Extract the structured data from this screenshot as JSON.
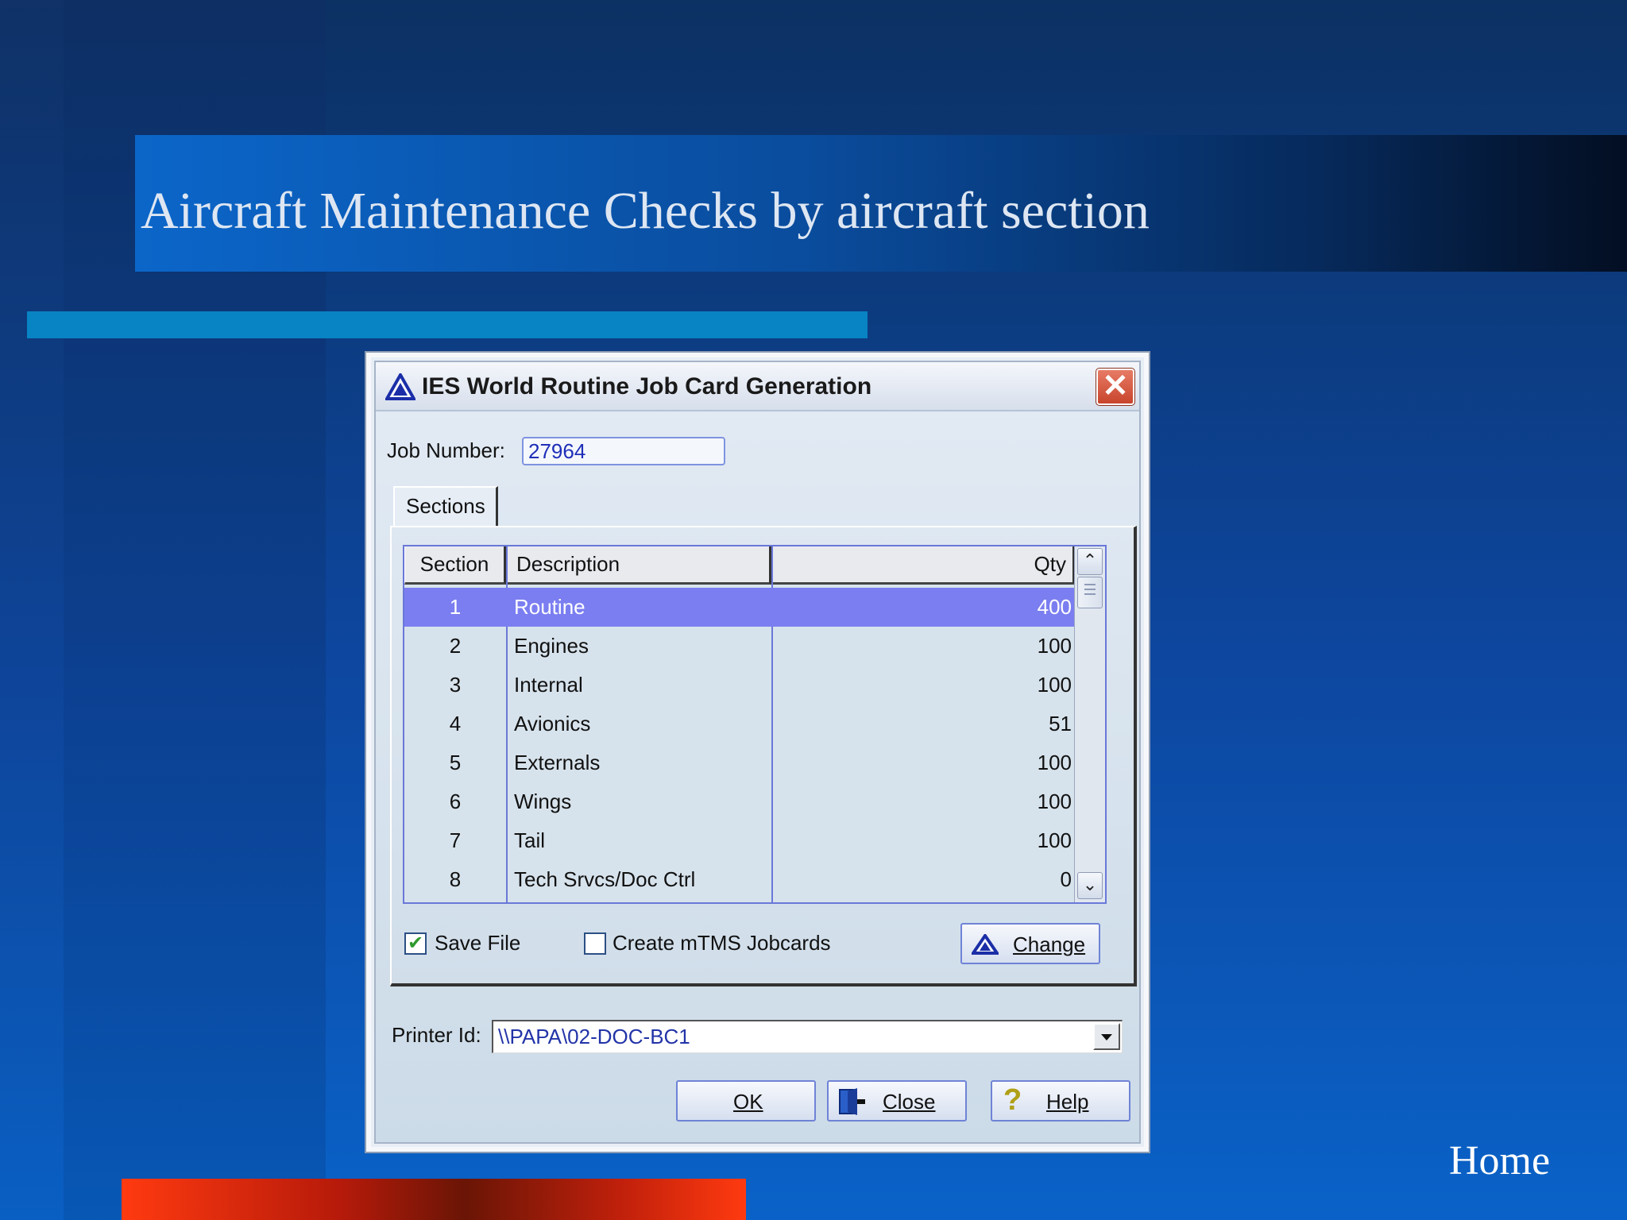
{
  "slide": {
    "title": "Aircraft Maintenance Checks by aircraft section",
    "home_link": "Home"
  },
  "dialog": {
    "title": "IES World Routine Job Card Generation",
    "close_glyph": "✕",
    "job_number_label": "Job Number:",
    "job_number_value": "27964",
    "tab_label": "Sections",
    "grid": {
      "headers": {
        "section": "Section",
        "description": "Description",
        "qty": "Qty"
      },
      "rows": [
        {
          "section": "1",
          "description": "Routine",
          "qty": "400",
          "selected": true
        },
        {
          "section": "2",
          "description": "Engines",
          "qty": "100"
        },
        {
          "section": "3",
          "description": "Internal",
          "qty": "100"
        },
        {
          "section": "4",
          "description": "Avionics",
          "qty": "51"
        },
        {
          "section": "5",
          "description": "Externals",
          "qty": "100"
        },
        {
          "section": "6",
          "description": "Wings",
          "qty": "100"
        },
        {
          "section": "7",
          "description": "Tail",
          "qty": "100"
        },
        {
          "section": "8",
          "description": "Tech Srvcs/Doc Ctrl",
          "qty": "0"
        }
      ],
      "scroll_up_glyph": "⌃",
      "scroll_down_glyph": "⌄"
    },
    "save_file": {
      "label": "Save File",
      "checked": true
    },
    "create_mtms": {
      "label": "Create mTMS Jobcards",
      "checked": false
    },
    "change_button": "Change",
    "printer_label": "Printer Id:",
    "printer_value": "\\\\PAPA\\02-DOC-BC1",
    "ok_button": "OK",
    "close_button": "Close",
    "help_button": "Help",
    "help_glyph": "?"
  },
  "colors": {
    "selection": "#7b7ef0",
    "grid_border": "#6a78d8",
    "accent_bar": "#0883c4",
    "close_red": "#c8442c"
  },
  "icons": [
    "warning-triangle-icon",
    "close-icon",
    "door-exit-icon",
    "help-question-icon",
    "chevron-up-icon",
    "chevron-down-icon",
    "dropdown-arrow-icon",
    "checkmark-icon"
  ]
}
